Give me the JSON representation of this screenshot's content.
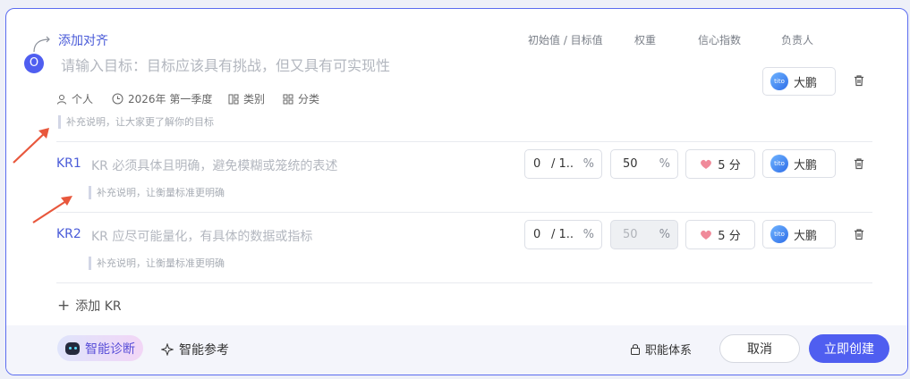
{
  "align_link": "添加对齐",
  "columns": {
    "value": "初始值 / 目标值",
    "weight": "权重",
    "confidence": "信心指数",
    "owner": "负责人"
  },
  "objective": {
    "badge": "O",
    "placeholder": "请输入目标：目标应该具有挑战，但又具有可实现性",
    "meta": {
      "type": "个人",
      "period": "2026年 第一季度",
      "category": "类别",
      "group": "分类"
    },
    "note": "补充说明，让大家更了解你的目标",
    "owner": "大鹏"
  },
  "key_results": [
    {
      "label": "KR1",
      "placeholder": "KR 必须具体且明确，避免模糊或笼统的表述",
      "initial": "0",
      "target": "/ 1..",
      "unit": "%",
      "weight": "50",
      "weight_disabled": false,
      "confidence": "5 分",
      "owner": "大鹏",
      "note": "补充说明，让衡量标准更明确"
    },
    {
      "label": "KR2",
      "placeholder": "KR 应尽可能量化，有具体的数据或指标",
      "initial": "0",
      "target": "/ 1..",
      "unit": "%",
      "weight": "50",
      "weight_disabled": true,
      "confidence": "5 分",
      "owner": "大鹏",
      "note": "补充说明，让衡量标准更明确"
    }
  ],
  "add_kr": "添加 KR",
  "footer": {
    "diagnose": "智能诊断",
    "reference": "智能参考",
    "system": "职能体系",
    "cancel": "取消",
    "create": "立即创建"
  },
  "avatar_text": "tito",
  "colors": {
    "accent": "#4f5ef0",
    "annotation_arrow": "#e8573c"
  }
}
